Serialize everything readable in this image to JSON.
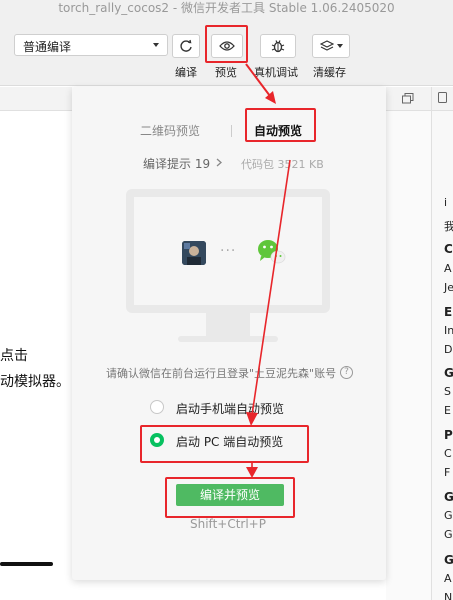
{
  "window": {
    "title": "torch_rally_cocos2 - 微信开发者工具 Stable 1.06.2405020"
  },
  "toolbar": {
    "mode": "普通编译",
    "compile_label": "编译",
    "preview_label": "预览",
    "remote_debug_label": "真机调试",
    "clear_cache_label": "清缓存"
  },
  "left_panel": {
    "line1": "点击",
    "line2": "动模拟器。"
  },
  "preview_popover": {
    "tab_qr": "二维码预览",
    "tab_auto": "自动预览",
    "compile_hint": "编译提示 19",
    "package_size": "代码包 3521 KB",
    "confirm_text": "请确认微信在前台运行且登录\"土豆泥先森\"账号",
    "help_icon": "question-circle-icon",
    "option_mobile": "启动手机端自动预览",
    "option_pc": "启动 PC 端自动预览",
    "selected_option": "启动 PC 端自动预览",
    "compile_preview_button": "编译并预览",
    "shortcut": "Shift+Ctrl+P",
    "ellipsis": "···"
  },
  "right_panel": {
    "items": [
      {
        "text": "i",
        "bold": false
      },
      {
        "text": "我",
        "bold": false
      },
      {
        "text": "C",
        "bold": true
      },
      {
        "text": "A",
        "bold": false
      },
      {
        "text": "Je",
        "bold": false
      },
      {
        "text": "E",
        "bold": true
      },
      {
        "text": "In",
        "bold": false
      },
      {
        "text": "D",
        "bold": false
      },
      {
        "text": "G",
        "bold": true
      },
      {
        "text": "S",
        "bold": false
      },
      {
        "text": "E",
        "bold": false
      },
      {
        "text": "P",
        "bold": true
      },
      {
        "text": "C",
        "bold": false
      },
      {
        "text": "F",
        "bold": false
      },
      {
        "text": "G",
        "bold": true
      },
      {
        "text": "G",
        "bold": false
      },
      {
        "text": "G",
        "bold": false
      },
      {
        "text": "G",
        "bold": true
      },
      {
        "text": "A",
        "bold": false
      },
      {
        "text": "N",
        "bold": false
      }
    ]
  },
  "colors": {
    "accent_green": "#07c160",
    "button_green": "#4fba62",
    "annotation_red": "#e8262b"
  }
}
